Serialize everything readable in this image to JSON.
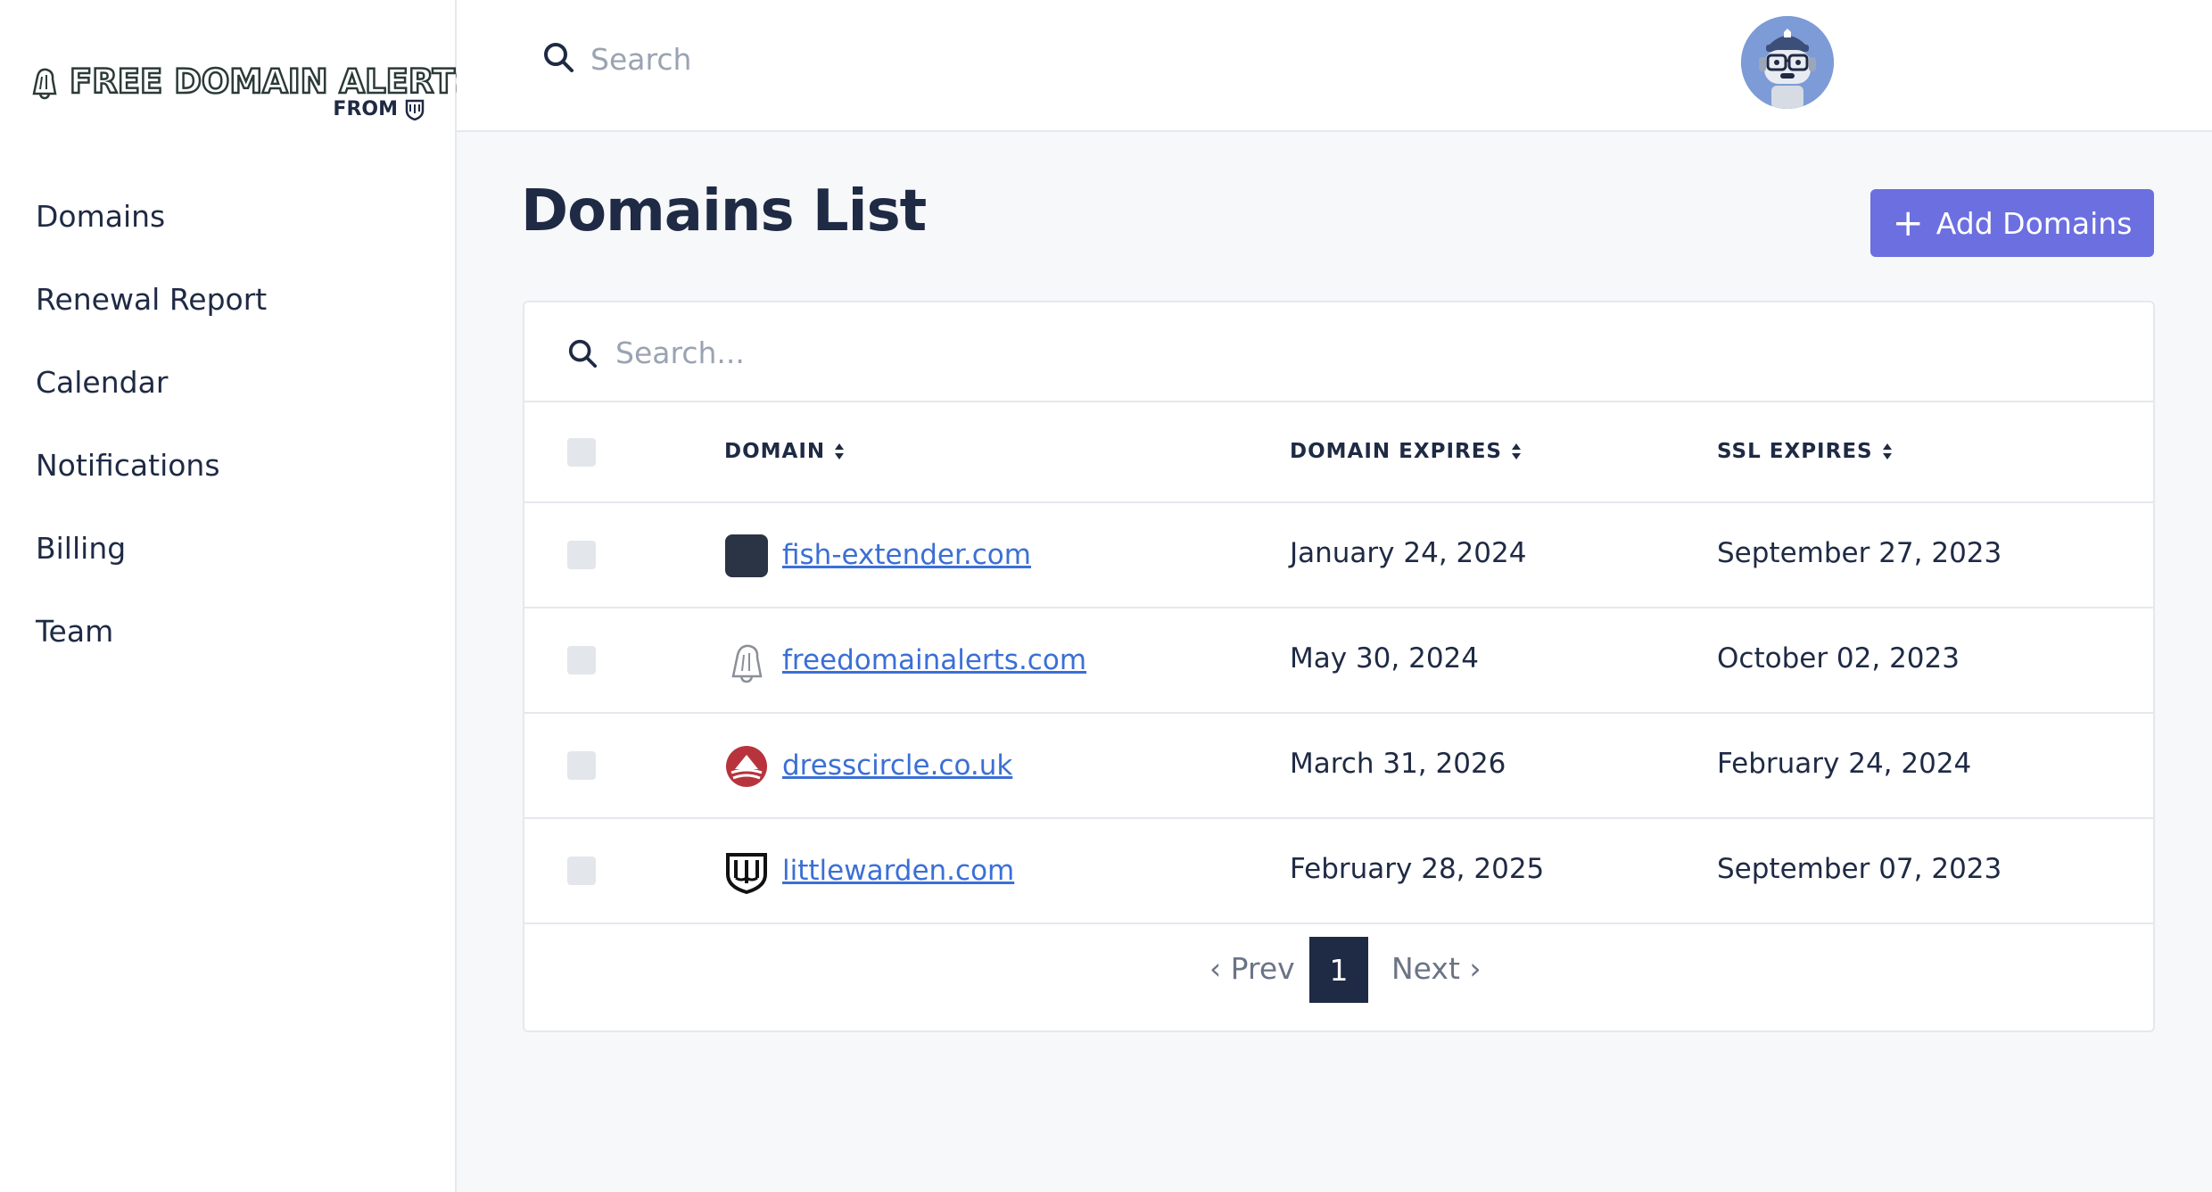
{
  "brand": {
    "title": "FREE DOMAIN ALERTS",
    "from": "FROM"
  },
  "sidebar": {
    "items": [
      {
        "label": "Domains"
      },
      {
        "label": "Renewal Report"
      },
      {
        "label": "Calendar"
      },
      {
        "label": "Notifications"
      },
      {
        "label": "Billing"
      },
      {
        "label": "Team"
      }
    ]
  },
  "topbar": {
    "search_placeholder": "Search",
    "avatar_icon": "robot-avatar-icon"
  },
  "main": {
    "title": "Domains List",
    "add_button_plus": "+",
    "add_button_label": "Add Domains",
    "table_search_placeholder": "Search..."
  },
  "table": {
    "columns": [
      "DOMAIN",
      "DOMAIN EXPIRES",
      "SSL EXPIRES"
    ],
    "rows": [
      {
        "domain": "fish-extender.com",
        "domain_expires": "January 24, 2024",
        "ssl_expires": "September 27, 2023",
        "favicon": "dark-square-icon"
      },
      {
        "domain": "freedomainalerts.com",
        "domain_expires": "May 30, 2024",
        "ssl_expires": "October 02, 2023",
        "favicon": "bell-icon"
      },
      {
        "domain": "dresscircle.co.uk",
        "domain_expires": "March 31, 2026",
        "ssl_expires": "February 24, 2024",
        "favicon": "dresscircle-logo-icon"
      },
      {
        "domain": "littlewarden.com",
        "domain_expires": "February 28, 2025",
        "ssl_expires": "September 07, 2023",
        "favicon": "littlewarden-shield-icon"
      }
    ]
  },
  "pagination": {
    "prev": "‹ Prev",
    "current": "1",
    "next": "Next ›"
  },
  "colors": {
    "accent": "#6b6fe0",
    "link": "#3b6fd6",
    "text": "#1f2a44",
    "muted": "#9aa3b2",
    "background": "#f7f8fa"
  }
}
